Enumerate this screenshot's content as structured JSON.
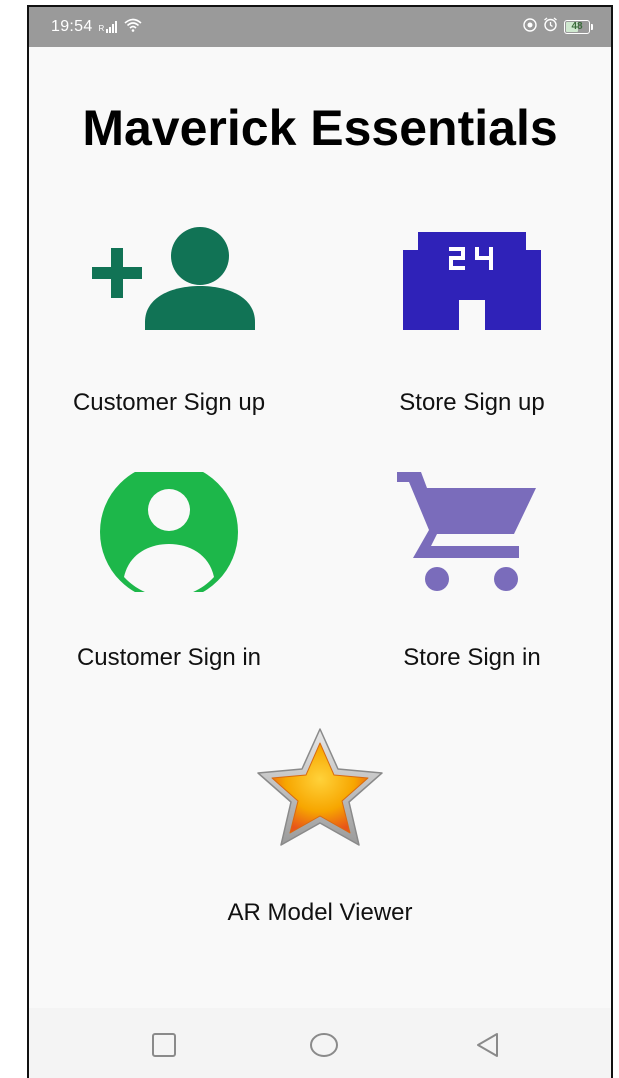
{
  "status_bar": {
    "time": "19:54",
    "signal_text": "R",
    "battery_level": "48",
    "icons": [
      "signal-icon",
      "wifi-icon",
      "location-icon",
      "alarm-icon",
      "battery-icon"
    ]
  },
  "app": {
    "title": "Maverick Essentials"
  },
  "tiles": [
    {
      "label": "Customer Sign up",
      "icon": "add-person-icon",
      "color": "#117355"
    },
    {
      "label": "Store Sign up",
      "icon": "store-24-icon",
      "color": "#2f22b8"
    },
    {
      "label": "Customer Sign in",
      "icon": "account-circle-icon",
      "color": "#1db74a"
    },
    {
      "label": "Store Sign in",
      "icon": "shopping-cart-icon",
      "color": "#7a6cbb"
    },
    {
      "label": "AR Model Viewer",
      "icon": "star-icon",
      "color": "#f7a600"
    }
  ],
  "nav_bar": {
    "buttons": [
      "recents-button",
      "home-button",
      "back-button"
    ]
  }
}
